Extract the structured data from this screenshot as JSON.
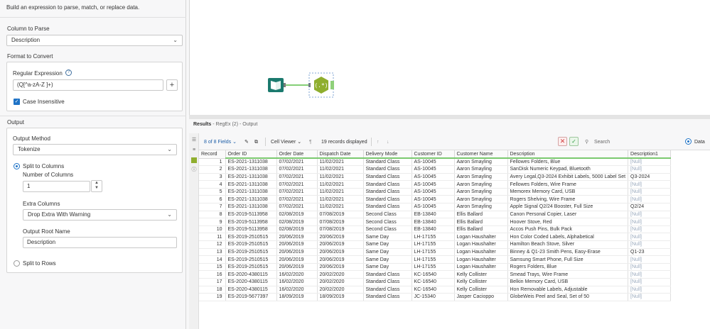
{
  "config": {
    "subtitle": "Build an expression to parse, match, or replace data.",
    "column_to_parse_label": "Column to Parse",
    "column_to_parse_value": "Description",
    "format_label": "Format to Convert",
    "regex_label": "Regular Expression",
    "regex_value": "(Q[^a-zA-Z ]+)",
    "case_insensitive_label": "Case Insensitive",
    "case_insensitive_checked": true,
    "output_label": "Output",
    "output_method_label": "Output Method",
    "output_method_value": "Tokenize",
    "split_columns_label": "Split to Columns",
    "num_columns_label": "Number of Columns",
    "num_columns_value": "1",
    "extra_columns_label": "Extra Columns",
    "extra_columns_value": "Drop Extra With Warning",
    "output_root_label": "Output Root Name",
    "output_root_value": "Description",
    "split_rows_label": "Split to Rows"
  },
  "results": {
    "title": "Results",
    "subtitle": "- RegEx (2) - Output",
    "fields_label": "8 of 8 Fields",
    "viewer_label": "Cell Viewer",
    "records_label": "19 records displayed",
    "search_placeholder": "Search",
    "data_label": "Data"
  },
  "table": {
    "headers": [
      "Record",
      "Order ID",
      "Order Date",
      "Dispatch Date",
      "Delivery Mode",
      "Customer ID",
      "Customer Name",
      "Description",
      "Description1"
    ],
    "rows": [
      [
        "1",
        "ES-2021-1311038",
        "07/02/2021",
        "11/02/2021",
        "Standard Class",
        "AS-10045",
        "Aaron Smayling",
        "Fellowes Folders, Blue",
        "[Null]"
      ],
      [
        "2",
        "ES-2021-1311038",
        "07/02/2021",
        "11/02/2021",
        "Standard Class",
        "AS-10045",
        "Aaron Smayling",
        "SanDisk Numeric Keypad, Bluetooth",
        "[Null]"
      ],
      [
        "3",
        "ES-2021-1311038",
        "07/02/2021",
        "11/02/2021",
        "Standard Class",
        "AS-10045",
        "Aaron Smayling",
        "Avery Legal,Q3-2024 Exhibit Labels, 5000 Label Set",
        "Q3-2024"
      ],
      [
        "4",
        "ES-2021-1311038",
        "07/02/2021",
        "11/02/2021",
        "Standard Class",
        "AS-10045",
        "Aaron Smayling",
        "Fellowes Folders, Wire Frame",
        "[Null]"
      ],
      [
        "5",
        "ES-2021-1311038",
        "07/02/2021",
        "11/02/2021",
        "Standard Class",
        "AS-10045",
        "Aaron Smayling",
        "Memorex Memory Card, USB",
        "[Null]"
      ],
      [
        "6",
        "ES-2021-1311038",
        "07/02/2021",
        "11/02/2021",
        "Standard Class",
        "AS-10045",
        "Aaron Smayling",
        "Rogers Shelving, Wire Frame",
        "[Null]"
      ],
      [
        "7",
        "ES-2021-1311038",
        "07/02/2021",
        "11/02/2021",
        "Standard Class",
        "AS-10045",
        "Aaron Smayling",
        "Apple Signal Q2/24 Booster, Full Size",
        "Q2/24"
      ],
      [
        "8",
        "ES-2019-5113958",
        "02/08/2019",
        "07/08/2019",
        "Second Class",
        "EB-13840",
        "Ellis Ballard",
        "Canon Personal Copier, Laser",
        "[Null]"
      ],
      [
        "9",
        "ES-2019-5113958",
        "02/08/2019",
        "07/08/2019",
        "Second Class",
        "EB-13840",
        "Ellis Ballard",
        "Hoover Stove, Red",
        "[Null]"
      ],
      [
        "10",
        "ES-2019-5113958",
        "02/08/2019",
        "07/08/2019",
        "Second Class",
        "EB-13840",
        "Ellis Ballard",
        "Accos Push Pins, Bulk Pack",
        "[Null]"
      ],
      [
        "11",
        "ES-2019-2510515",
        "20/06/2019",
        "20/06/2019",
        "Same Day",
        "LH-17155",
        "Logan Haushalter",
        "Hon Color Coded Labels, Alphabetical",
        "[Null]"
      ],
      [
        "12",
        "ES-2019-2510515",
        "20/06/2019",
        "20/06/2019",
        "Same Day",
        "LH-17155",
        "Logan Haushalter",
        "Hamilton Beach Stove, Silver",
        "[Null]"
      ],
      [
        "13",
        "ES-2019-2510515",
        "20/06/2019",
        "20/06/2019",
        "Same Day",
        "LH-17155",
        "Logan Haushalter",
        "Binney & Q1-23 Smith Pens, Easy-Erase",
        "Q1-23"
      ],
      [
        "14",
        "ES-2019-2510515",
        "20/06/2019",
        "20/06/2019",
        "Same Day",
        "LH-17155",
        "Logan Haushalter",
        "Samsung Smart Phone, Full Size",
        "[Null]"
      ],
      [
        "15",
        "ES-2019-2510515",
        "20/06/2019",
        "20/06/2019",
        "Same Day",
        "LH-17155",
        "Logan Haushalter",
        "Rogers Folders, Blue",
        "[Null]"
      ],
      [
        "16",
        "ES-2020-4380115",
        "16/02/2020",
        "20/02/2020",
        "Standard Class",
        "KC-16540",
        "Kelly Collister",
        "Smead Trays, Wire Frame",
        "[Null]"
      ],
      [
        "17",
        "ES-2020-4380115",
        "16/02/2020",
        "20/02/2020",
        "Standard Class",
        "KC-16540",
        "Kelly Collister",
        "Belkin Memory Card, USB",
        "[Null]"
      ],
      [
        "18",
        "ES-2020-4380115",
        "16/02/2020",
        "20/02/2020",
        "Standard Class",
        "KC-16540",
        "Kelly Collister",
        "Hon Removable Labels, Adjustable",
        "[Null]"
      ],
      [
        "19",
        "ES-2019-5677397",
        "18/09/2019",
        "18/09/2019",
        "Standard Class",
        "JC-15340",
        "Jasper Cacioppo",
        "GlobeWeis Peel and Seal, Set of 50",
        "[Null]"
      ]
    ]
  },
  "colors": {
    "accent": "#1f73c6",
    "input_tool": "#1b7a6e",
    "regex_tool": "#8fae2e",
    "connector": "#5bbf4a"
  },
  "icons": {
    "input_tool": "book-icon",
    "regex_tool": "regex-hexagon-icon"
  }
}
